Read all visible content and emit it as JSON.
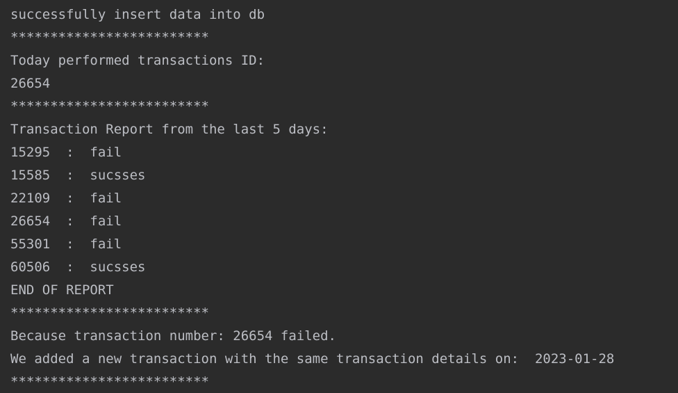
{
  "console": {
    "lines": [
      "successfully insert data into db",
      "*************************",
      "Today performed transactions ID:",
      "26654",
      "*************************",
      "Transaction Report from the last 5 days:",
      "15295  :  fail",
      "15585  :  sucsses",
      "22109  :  fail",
      "26654  :  fail",
      "55301  :  fail",
      "60506  :  sucsses",
      "END OF REPORT",
      "*************************",
      "Because transaction number: 26654 failed.",
      "We added a new transaction with the same transaction details on:  2023-01-28",
      "*************************"
    ]
  }
}
